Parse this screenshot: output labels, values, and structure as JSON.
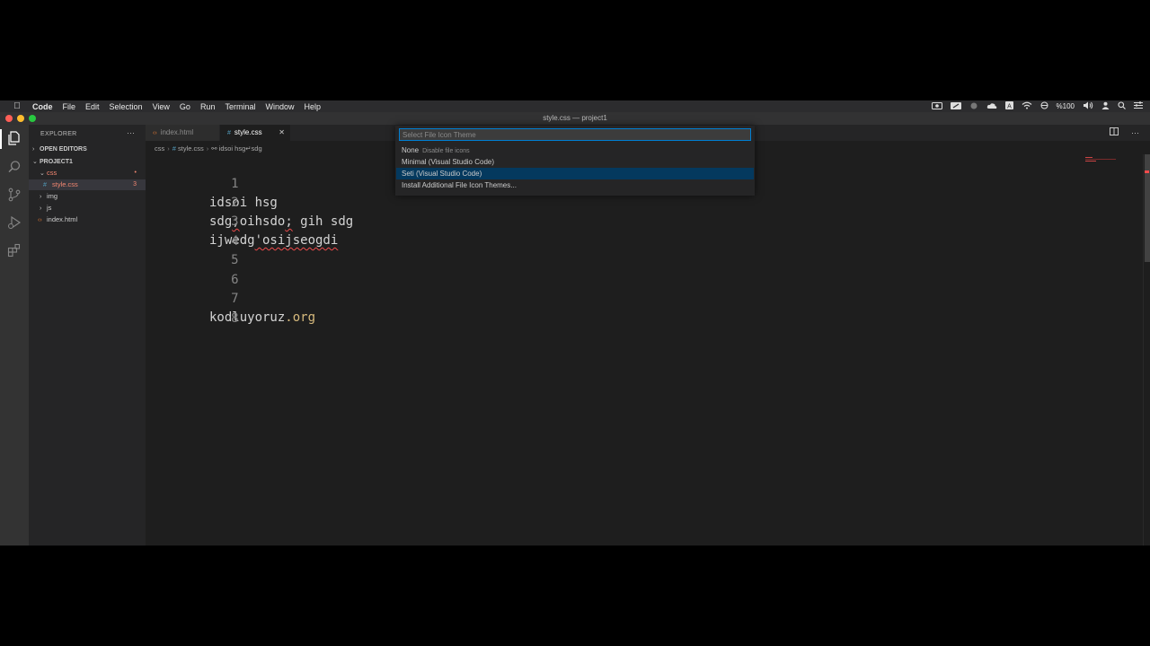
{
  "menubar": {
    "app_name": "Code",
    "items": [
      "File",
      "Edit",
      "Selection",
      "View",
      "Go",
      "Run",
      "Terminal",
      "Window",
      "Help"
    ],
    "battery": "%100"
  },
  "window": {
    "title": "style.css — project1"
  },
  "sidebar": {
    "header": "EXPLORER",
    "open_editors": "OPEN EDITORS",
    "project": "PROJECT1",
    "tree": {
      "css_folder": "css",
      "css_dot": "•",
      "style_file": "style.css",
      "style_badge": "3",
      "img_folder": "img",
      "js_folder": "js",
      "index_file": "index.html"
    }
  },
  "tabs": [
    {
      "label": "index.html"
    },
    {
      "label": "style.css"
    }
  ],
  "breadcrumb": {
    "folder": "css",
    "file": "style.css",
    "symbol": "idsoi hsg↵sdg"
  },
  "editor": {
    "lines": [
      {
        "num": "1",
        "text": "idsoi hsg"
      },
      {
        "num": "2",
        "a": "sdg",
        "b": ";",
        "c": "oihsdo",
        "d": ";",
        "e": " gih sdg"
      },
      {
        "num": "3",
        "a": "ijwedg",
        "b": "'osijseogdi"
      },
      {
        "num": "4",
        "text": ""
      },
      {
        "num": "5",
        "text": ""
      },
      {
        "num": "6",
        "text": ""
      },
      {
        "num": "7",
        "a": "kodluyoruz",
        "b": ".org"
      },
      {
        "num": "8",
        "text": ""
      }
    ]
  },
  "quickpick": {
    "placeholder": "Select File Icon Theme",
    "items": [
      {
        "label": "None",
        "description": "Disable file icons"
      },
      {
        "label": "Minimal (Visual Studio Code)",
        "description": ""
      },
      {
        "label": "Seti (Visual Studio Code)",
        "description": ""
      },
      {
        "label": "Install Additional File Icon Themes...",
        "description": ""
      }
    ],
    "selected_index": 2
  },
  "colors": {
    "accent": "#007fd4",
    "error": "#f48771",
    "selection": "#04395e",
    "string": "#d7ba7d"
  }
}
